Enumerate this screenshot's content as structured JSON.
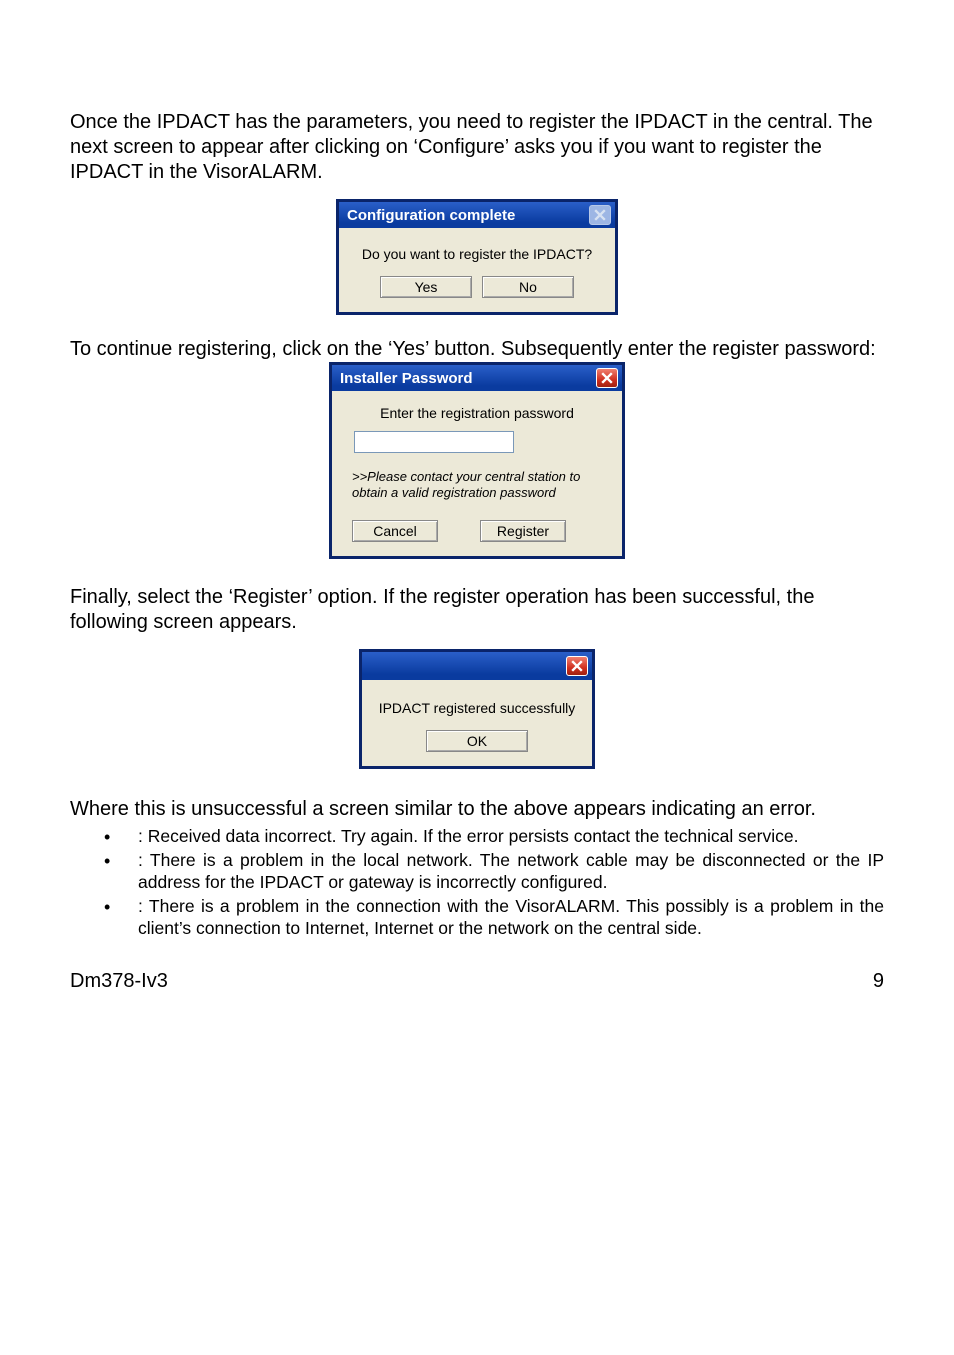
{
  "para1": "Once the IPDACT has the parameters, you need to register the IPDACT in the central.  The next screen to appear after clicking on ‘Configure’ asks you if you want to register the IPDACT in the VisorALARM.",
  "dlg1": {
    "title": "Configuration complete",
    "question": "Do you want to register the IPDACT?",
    "yes": "Yes",
    "no": "No"
  },
  "para2": "To continue registering, click on the ‘Yes’ button.  Subsequently enter the register password:",
  "dlg2": {
    "title": "Installer Password",
    "label": "Enter the registration password",
    "input_value": "",
    "hint": ">>Please contact your central station to obtain a valid registration password",
    "cancel": "Cancel",
    "register": "Register"
  },
  "para3": "Finally, select the ‘Register’ option.  If the register operation has been successful, the following screen appears.",
  "dlg3": {
    "title": "",
    "message": "IPDACT registered successfully",
    "ok": "OK"
  },
  "para4": "Where this is unsuccessful a screen similar to the above appears indicating an error.",
  "bullets": [
    ": Received data incorrect. Try again. If the error persists contact the technical service.",
    ": There is a problem in the local network. The network cable may be disconnected or the IP address for the IPDACT or gateway is incorrectly configured.",
    ": There is a problem in the connection with the VisorALARM. This possibly is a problem in the client’s connection to Internet, Internet or the network on the central side."
  ],
  "footer_left": "Dm378-Iv3",
  "footer_right": "9"
}
